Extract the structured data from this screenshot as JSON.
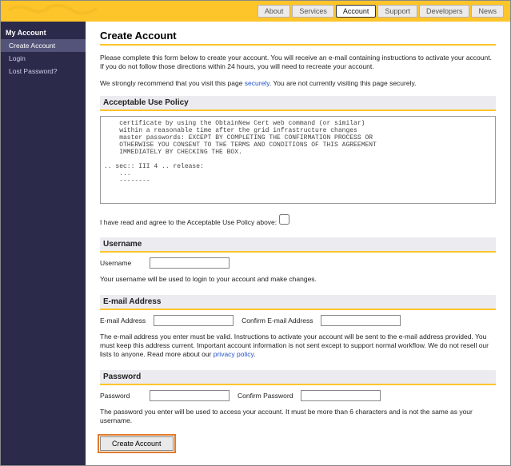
{
  "topnav": {
    "items": [
      {
        "label": "About"
      },
      {
        "label": "Services"
      },
      {
        "label": "Account"
      },
      {
        "label": "Support"
      },
      {
        "label": "Developers"
      },
      {
        "label": "News"
      }
    ],
    "active_index": 2
  },
  "sidebar": {
    "heading": "My Account",
    "items": [
      {
        "label": "Create Account"
      },
      {
        "label": "Login"
      },
      {
        "label": "Lost Password?"
      }
    ],
    "active_index": 0
  },
  "page": {
    "title": "Create Account",
    "intro1": "Please complete this form below to create your account. You will receive an e-mail containing instructions to activate your account. If you do not follow those directions within 24 hours, you will need to recreate your account.",
    "intro2a": "We strongly recommend that you visit this page ",
    "intro2_link": "securely",
    "intro2b": ". You are not currently visiting this page securely.",
    "aup_heading": "Acceptable Use Policy",
    "aup_text": "    certificate by using the ObtainNew Cert web command (or similar)\n    within a reasonable time after the grid infrastructure changes\n    master passwords: EXCEPT BY COMPLETING THE CONFIRMATION PROCESS OR\n    OTHERWISE YOU CONSENT TO THE TERMS AND CONDITIONS OF THIS AGREEMENT\n    IMMEDIATELY BY CHECKING THE BOX.\n\n.. sec:: III 4 .. release:\n    ...\n    --------",
    "ack_label": "I have read and agree to the Acceptable Use Policy above:",
    "username_heading": "Username",
    "username_label": "Username",
    "username_help": "Your username will be used to login to your account and make changes.",
    "email_heading": "E-mail Address",
    "email_label": "E-mail Address",
    "email_confirm_label": "Confirm E-mail Address",
    "email_help": "The e-mail address you enter must be valid. Instructions to activate your account will be sent to the e-mail address provided. You must keep this address current. Important account information is not sent except to support normal workflow. We do not resell our lists to anyone. Read more about our ",
    "email_help_link": "privacy policy",
    "email_help_tail": ".",
    "password_heading": "Password",
    "password_label": "Password",
    "password_confirm_label": "Confirm Password",
    "password_help": "The password you enter will be used to access your account. It must be more than 6 characters and is not the same as your username.",
    "submit_label": "Create Account"
  },
  "form_values": {
    "username": "",
    "email": "",
    "email_confirm": "",
    "password": "",
    "password_confirm": "",
    "ack_checked": false
  }
}
